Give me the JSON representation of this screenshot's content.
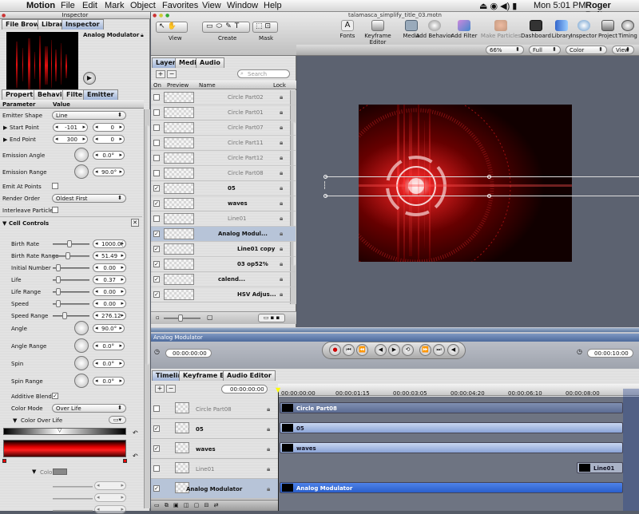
{
  "menubar": {
    "apple": "",
    "app": "Motion",
    "items": [
      "File",
      "Edit",
      "Mark",
      "Object",
      "Favorites",
      "View",
      "Window",
      "Help"
    ],
    "clock": "Mon 5:01 PM",
    "user": "Roger Bolton"
  },
  "inspector": {
    "title": "Inspector",
    "tabs": [
      "File Browser",
      "Library",
      "Inspector"
    ],
    "preview_title": "Analog Modulator",
    "subtabs": [
      "Properties",
      "Behaviors",
      "Filters",
      "Emitter"
    ],
    "col_param": "Parameter",
    "col_value": "Value",
    "rows": [
      {
        "label": "Emitter Shape",
        "pop": "Line"
      },
      {
        "label": "Start Point",
        "v1": "-101",
        "v2": "0"
      },
      {
        "label": "End Point",
        "v1": "300",
        "v2": "0"
      },
      {
        "label": "Emission Angle",
        "dial": "0.0°"
      },
      {
        "label": "Emission Range",
        "dial": "90.0°"
      },
      {
        "label": "Emit At Points",
        "check": ""
      },
      {
        "label": "Render Order",
        "pop": "Oldest First"
      },
      {
        "label": "Interleave Particles",
        "check": ""
      },
      {
        "label": "Cell Controls"
      },
      {
        "label": "Birth Rate",
        "slide": "1000.0("
      },
      {
        "label": "Birth Rate Range",
        "slide": "51.49"
      },
      {
        "label": "Initial Number",
        "slide": "0.00"
      },
      {
        "label": "Life",
        "slide": "0.37"
      },
      {
        "label": "Life Range",
        "slide": "0.00"
      },
      {
        "label": "Speed",
        "slide": "0.00"
      },
      {
        "label": "Speed Range",
        "slide": "276.12"
      },
      {
        "label": "Angle",
        "dial": "90.0°"
      },
      {
        "label": "Angle Range",
        "dial": "0.0°"
      },
      {
        "label": "Spin",
        "dial": "0.0°"
      },
      {
        "label": "Spin Range",
        "dial": "0.0°"
      },
      {
        "label": "Additive Blend",
        "check": "✓"
      },
      {
        "label": "Color Mode",
        "pop": "Over Life"
      },
      {
        "label": "Color Over Life"
      }
    ],
    "color_label": "Color"
  },
  "canvas": {
    "title": "talamasca_simplify_title_03.motn",
    "tools_labels": [
      "View",
      "Create",
      "Mask"
    ],
    "toolbar": [
      "Fonts",
      "Keyframe Editor",
      "Media",
      "Add Behavior",
      "Add Filter",
      "Make Particles",
      "Dashboard",
      "Library",
      "Inspector",
      "Project",
      "Timing"
    ],
    "zoom": "66%",
    "res": "Full",
    "channel": "Color",
    "view": "View"
  },
  "layers": {
    "tabs": [
      "Layers",
      "Media",
      "Audio"
    ],
    "search": "Search",
    "cols": [
      "On",
      "Preview",
      "Name",
      "Lock"
    ],
    "rows": [
      {
        "name": "Circle Part02",
        "on": ""
      },
      {
        "name": "Circle Part01",
        "on": ""
      },
      {
        "name": "Circle Part07",
        "on": ""
      },
      {
        "name": "Circle Part11",
        "on": ""
      },
      {
        "name": "Circle Part12",
        "on": ""
      },
      {
        "name": "Circle Part08",
        "on": ""
      },
      {
        "name": "05",
        "on": "✓"
      },
      {
        "name": "waves",
        "on": "✓"
      },
      {
        "name": "Line01",
        "on": ""
      },
      {
        "name": "Analog Modul...",
        "on": "✓"
      },
      {
        "name": "Line01 copy",
        "on": "✓"
      },
      {
        "name": "03 op52%",
        "on": "✓"
      },
      {
        "name": "calend...",
        "on": "✓"
      },
      {
        "name": "HSV Adjus...",
        "on": "✓"
      }
    ]
  },
  "transport": {
    "title": "Analog Modulator",
    "tc_left": "00:00:00:00",
    "tc_right": "00:00:10:00"
  },
  "timeline": {
    "tabs": [
      "Timeline",
      "Keyframe Editor",
      "Audio Editor"
    ],
    "tc": "00:00:00:00",
    "ruler": [
      "00:00:00:00",
      "00:00:01:15",
      "00:00:03:05",
      "00:00:04:20",
      "00:00:06:10",
      "00:00:08:00"
    ],
    "rows": [
      {
        "name": "Circle Part08",
        "on": ""
      },
      {
        "name": "05",
        "on": "✓"
      },
      {
        "name": "waves",
        "on": "✓"
      },
      {
        "name": "Line01",
        "on": ""
      },
      {
        "name": "Analog Modulator",
        "on": "✓"
      }
    ],
    "bars": [
      "Circle Part08",
      "05",
      "waves",
      "Line01",
      "Analog Modulator"
    ]
  }
}
